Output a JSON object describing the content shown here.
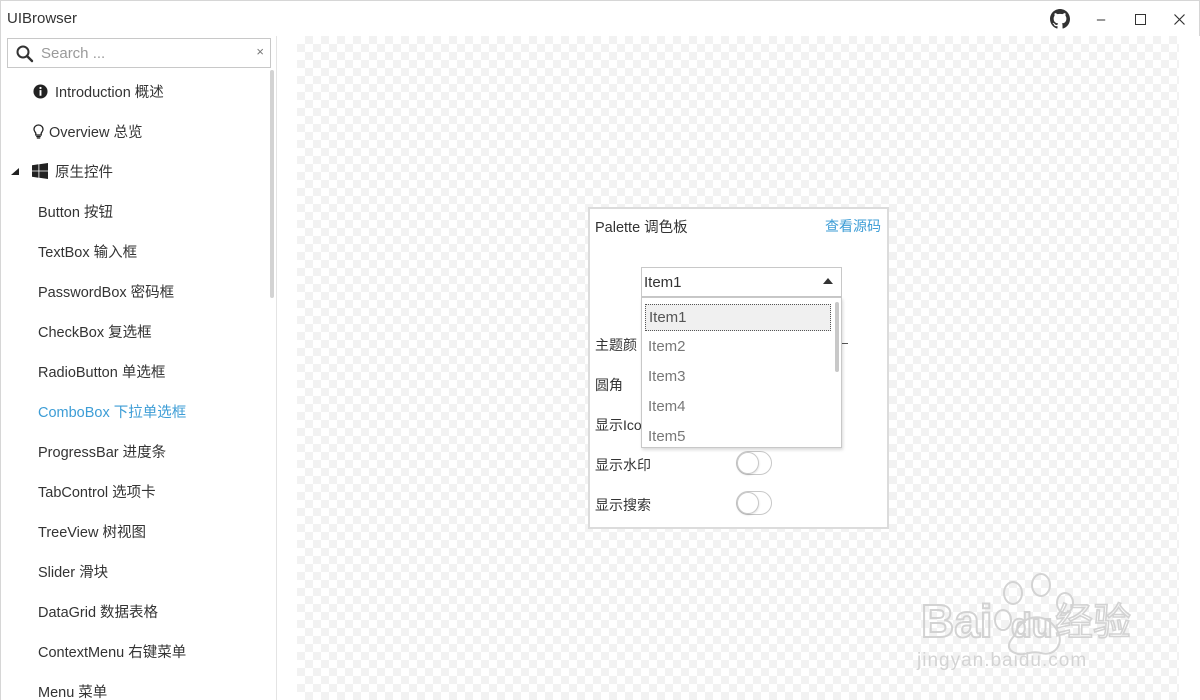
{
  "window": {
    "title": "UIBrowser",
    "github_icon": "github-icon",
    "minimize_glyph": "–",
    "maximize_glyph": "☐",
    "close_glyph": "✕"
  },
  "sidebar": {
    "search_placeholder": "Search ...",
    "clear_glyph": "×",
    "items": [
      {
        "label": "Introduction 概述",
        "icon": "info-icon"
      },
      {
        "label": "Overview 总览",
        "icon": "lightbulb-icon"
      },
      {
        "label": "原生控件",
        "icon": "windows-icon",
        "expanded": true
      },
      {
        "label": "Button 按钮"
      },
      {
        "label": "TextBox 输入框"
      },
      {
        "label": "PasswordBox 密码框"
      },
      {
        "label": "CheckBox 复选框"
      },
      {
        "label": "RadioButton 单选框"
      },
      {
        "label": "ComboBox 下拉单选框",
        "active": true
      },
      {
        "label": "ProgressBar 进度条"
      },
      {
        "label": "TabControl 选项卡"
      },
      {
        "label": "TreeView 树视图"
      },
      {
        "label": "Slider 滑块"
      },
      {
        "label": "DataGrid 数据表格"
      },
      {
        "label": "ContextMenu 右键菜单"
      },
      {
        "label": "Menu 菜单"
      }
    ],
    "active_color": "#3d9dd6"
  },
  "panel": {
    "title": "Palette 调色板",
    "source_link": "查看源码",
    "combo": {
      "selected": "Item1",
      "options": [
        "Item1",
        "Item2",
        "Item3",
        "Item4",
        "Item5"
      ]
    },
    "rows": [
      {
        "label": "主题颜色"
      },
      {
        "label": "圆角"
      },
      {
        "label": "显示Icon"
      },
      {
        "label": "显示水印",
        "toggle": false
      },
      {
        "label": "显示搜索",
        "toggle": false
      }
    ],
    "visible_row_labels": [
      "主题颜",
      "圆角",
      "显示Ico",
      "显示水印",
      "显示搜索"
    ]
  },
  "watermark": {
    "brand": "Bai",
    "brand_suffix": "du",
    "brand_cn": "经验",
    "sub": "jingyan.baidu.com"
  }
}
